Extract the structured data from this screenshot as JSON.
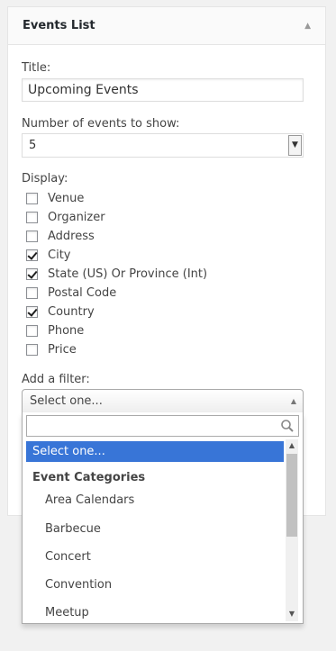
{
  "widget": {
    "title": "Events List",
    "toggle_icon": "triangle-up-icon"
  },
  "form": {
    "title_label": "Title:",
    "title_value": "Upcoming Events",
    "count_label": "Number of events to show:",
    "count_value": "5",
    "display_label": "Display:",
    "display_options": [
      {
        "label": "Venue",
        "checked": false
      },
      {
        "label": "Organizer",
        "checked": false
      },
      {
        "label": "Address",
        "checked": false
      },
      {
        "label": "City",
        "checked": true
      },
      {
        "label": "State (US) Or Province (Int)",
        "checked": true
      },
      {
        "label": "Postal Code",
        "checked": false
      },
      {
        "label": "Country",
        "checked": true
      },
      {
        "label": "Phone",
        "checked": false
      },
      {
        "label": "Price",
        "checked": false
      }
    ],
    "filter_label": "Add a filter:",
    "filter_value": "Select one..."
  },
  "dropdown": {
    "search_value": "",
    "highlighted_option": "Select one...",
    "group_label": "Event Categories",
    "options": [
      "Area Calendars",
      "Barbecue",
      "Concert",
      "Convention",
      "Meetup"
    ]
  },
  "colors": {
    "highlight": "#3875d7",
    "background": "#f1f1f1"
  }
}
